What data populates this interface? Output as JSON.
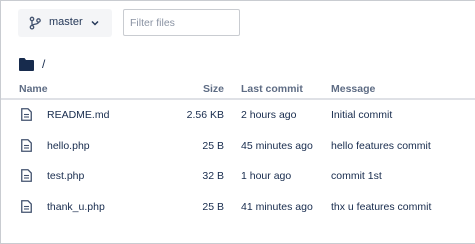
{
  "toolbar": {
    "branch_label": "master",
    "filter_placeholder": "Filter files"
  },
  "path": {
    "current": "/"
  },
  "table": {
    "headers": {
      "name": "Name",
      "size": "Size",
      "last_commit": "Last commit",
      "message": "Message"
    },
    "rows": [
      {
        "name": "README.md",
        "size": "2.56 KB",
        "last_commit": "2 hours ago",
        "message": "Initial commit"
      },
      {
        "name": "hello.php",
        "size": "25 B",
        "last_commit": "45 minutes ago",
        "message": "hello features commit"
      },
      {
        "name": "test.php",
        "size": "32 B",
        "last_commit": "1 hour ago",
        "message": "commit 1st"
      },
      {
        "name": "thank_u.php",
        "size": "25 B",
        "last_commit": "41 minutes ago",
        "message": "thx u features commit"
      }
    ]
  },
  "icons": {
    "branch": "git-branch-icon",
    "dropdown": "chevron-down-icon",
    "folder": "folder-icon",
    "file": "file-icon"
  },
  "colors": {
    "text": "#172b4d",
    "header_text": "#5e6c84",
    "button_bg": "#f4f5f7",
    "border": "#c9ccd1"
  }
}
